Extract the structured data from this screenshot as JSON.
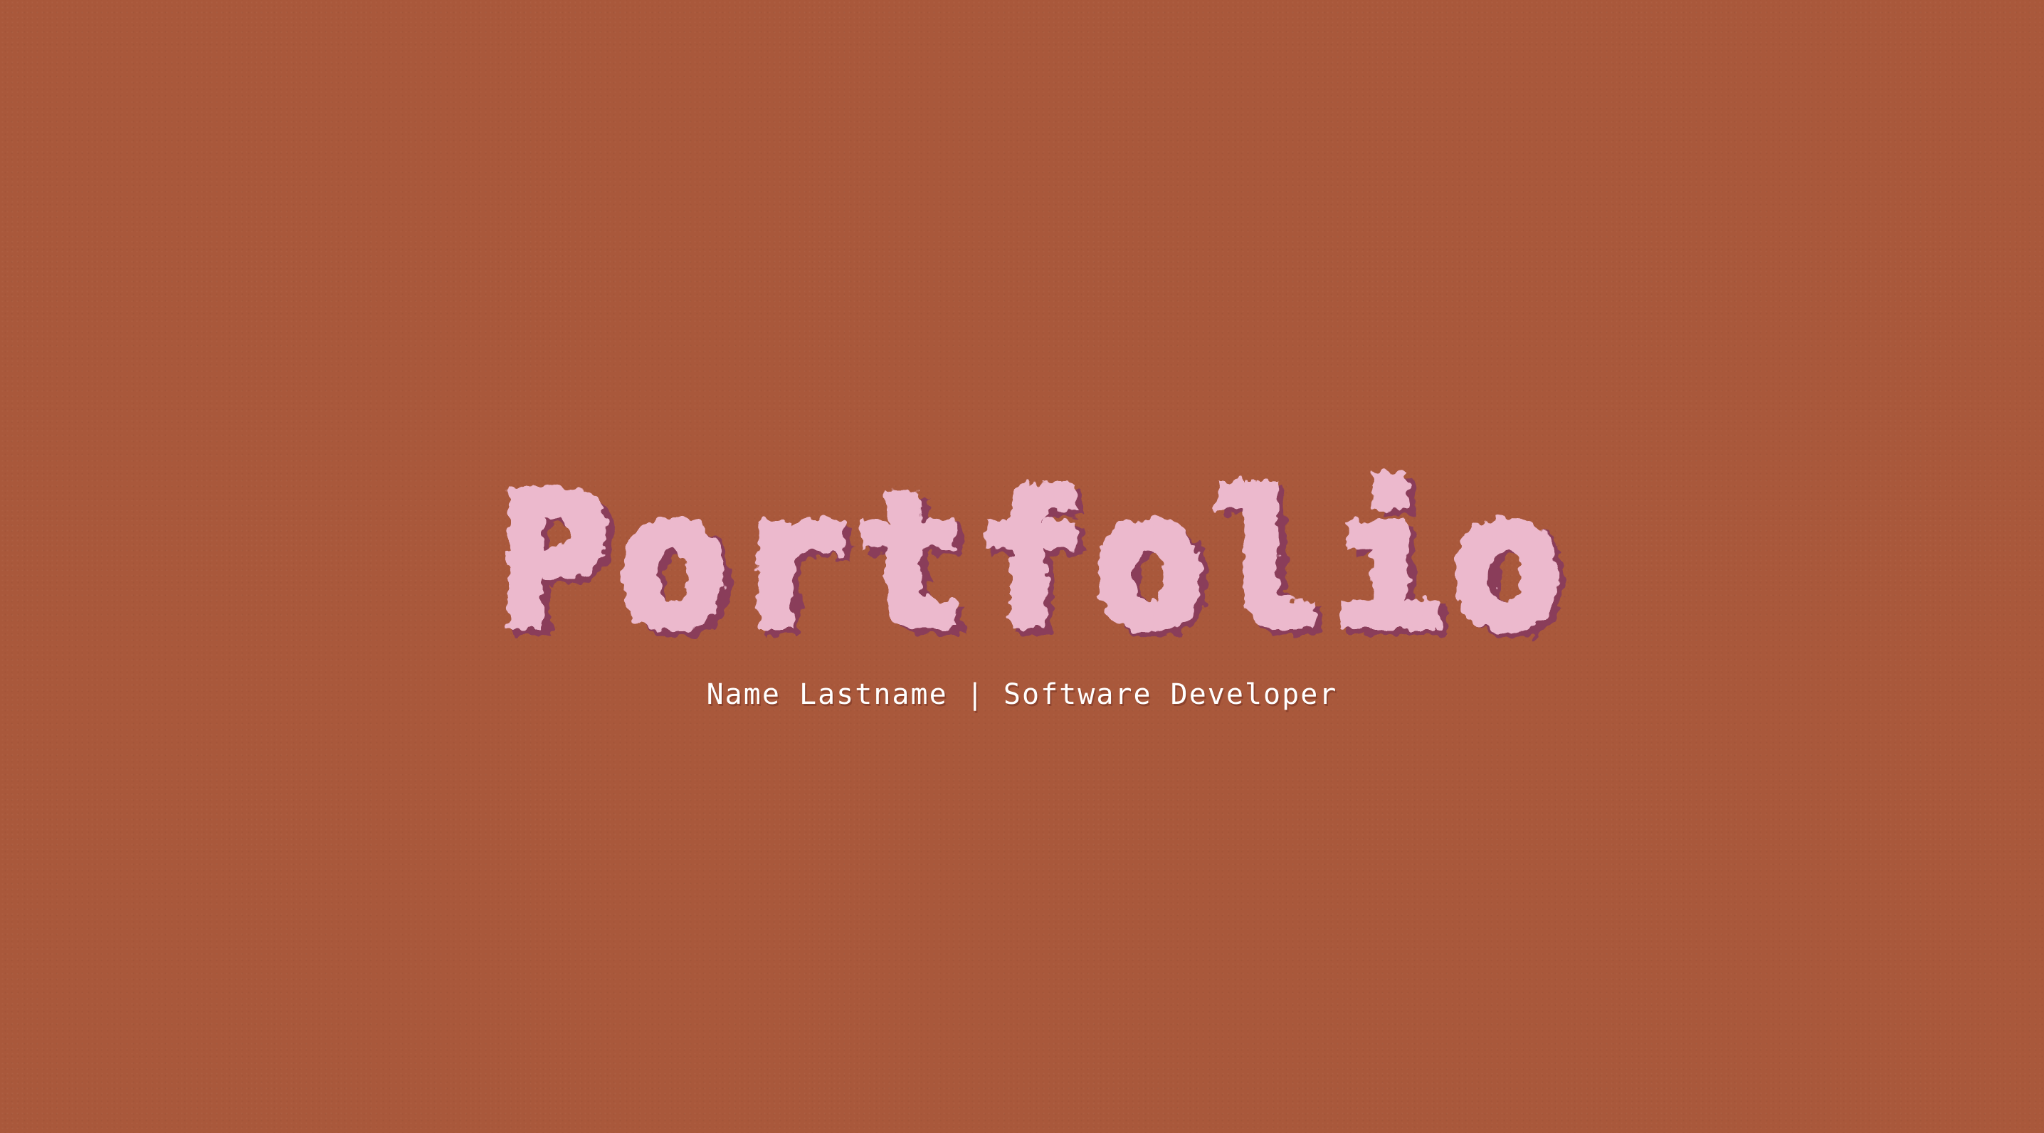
{
  "hero": {
    "title": "Portfolio",
    "subtitle": "Name Lastname | Software Developer"
  },
  "colors": {
    "background": "#a9583b",
    "title_fill": "#ecb9cd",
    "title_shadow": "#8a3d5a",
    "subtitle_text": "#ffffff"
  }
}
